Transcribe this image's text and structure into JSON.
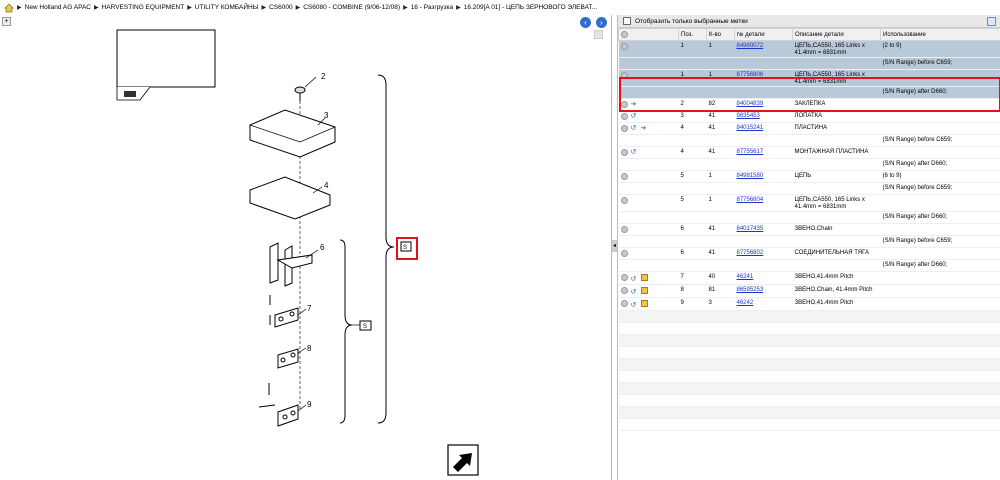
{
  "breadcrumb": {
    "items": [
      "New Holland AG APAC",
      "HARVESTING EQUIPMENT",
      "UTILITY КОМБАЙНЫ",
      "CS6000",
      "CS6080 - COMBINE (9/06-12/08)",
      "16 - Разгрузка",
      "16.209[A 01] - ЦЕПЬ ЗЕРНОВОГО ЭЛЕВАТ..."
    ]
  },
  "diagram": {
    "callouts": [
      "2",
      "3",
      "4",
      "6",
      "7",
      "8",
      "9"
    ],
    "box_s": "S",
    "box_s2": "S"
  },
  "filter": {
    "label": "Отобразить только выбранные метки"
  },
  "table": {
    "headers": [
      "",
      "Поз.",
      "К-во",
      "№ детали",
      "Описание детали",
      "Использование"
    ],
    "rows": [
      {
        "cls": "sel",
        "icons": [
          "dot"
        ],
        "pos": "1",
        "qty": "1",
        "part": "84980072",
        "desc": "ЦЕПЬ,CA550, 165 Links x 41.4mm = 6831mm",
        "usage": "(2 to 9)"
      },
      {
        "cls": "sel",
        "icons": [],
        "pos": "",
        "qty": "",
        "part": "",
        "desc": "",
        "usage": "(S/N Range) before C659;"
      },
      {
        "cls": "sel2",
        "icons": [
          "dot"
        ],
        "pos": "1",
        "qty": "1",
        "part": "87756806",
        "desc": "ЦЕПЬ,CA550, 165 Links x 41.4mm = 6831mm",
        "usage": ""
      },
      {
        "cls": "sel2",
        "icons": [],
        "pos": "",
        "qty": "",
        "part": "",
        "desc": "",
        "usage": "(S/N Range) after D660;"
      },
      {
        "cls": "",
        "icons": [
          "dot",
          "green"
        ],
        "pos": "2",
        "qty": "82",
        "part": "84004839",
        "desc": "ЗАКЛЕПКА",
        "usage": ""
      },
      {
        "cls": "",
        "icons": [
          "dot",
          "blue"
        ],
        "pos": "3",
        "qty": "41",
        "part": "9835453",
        "desc": "ЛОПАТКА",
        "usage": ""
      },
      {
        "cls": "",
        "icons": [
          "dot",
          "blue",
          "green"
        ],
        "pos": "4",
        "qty": "41",
        "part": "84015241",
        "desc": "ПЛАСТИНА",
        "usage": ""
      },
      {
        "cls": "",
        "icons": [],
        "pos": "",
        "qty": "",
        "part": "",
        "desc": "",
        "usage": "(S/N Range) before C659;"
      },
      {
        "cls": "",
        "icons": [
          "dot",
          "blue"
        ],
        "pos": "4",
        "qty": "41",
        "part": "87755617",
        "desc": "МОНТАЖНАЯ ПЛАСТИНА",
        "usage": ""
      },
      {
        "cls": "",
        "icons": [],
        "pos": "",
        "qty": "",
        "part": "",
        "desc": "",
        "usage": "(S/N Range) after D660;"
      },
      {
        "cls": "",
        "icons": [
          "dot"
        ],
        "pos": "5",
        "qty": "1",
        "part": "84981580",
        "desc": "ЦЕПЬ",
        "usage": "(6 to 9)"
      },
      {
        "cls": "",
        "icons": [],
        "pos": "",
        "qty": "",
        "part": "",
        "desc": "",
        "usage": "(S/N Range) before C659;"
      },
      {
        "cls": "",
        "icons": [
          "dot"
        ],
        "pos": "5",
        "qty": "1",
        "part": "87756804",
        "desc": "ЦЕПЬ,CA550, 165 Links x 41.4mm = 6831mm",
        "usage": ""
      },
      {
        "cls": "",
        "icons": [],
        "pos": "",
        "qty": "",
        "part": "",
        "desc": "",
        "usage": "(S/N Range) after D660;"
      },
      {
        "cls": "",
        "icons": [
          "dot"
        ],
        "pos": "6",
        "qty": "41",
        "part": "84017435",
        "desc": "ЗВЕНО,Chain",
        "usage": ""
      },
      {
        "cls": "",
        "icons": [],
        "pos": "",
        "qty": "",
        "part": "",
        "desc": "",
        "usage": "(S/N Range) before C659;"
      },
      {
        "cls": "",
        "icons": [
          "dot"
        ],
        "pos": "6",
        "qty": "41",
        "part": "87756802",
        "desc": "СОЕДИНИТЕЛЬНАЯ ТЯГА",
        "usage": ""
      },
      {
        "cls": "",
        "icons": [],
        "pos": "",
        "qty": "",
        "part": "",
        "desc": "",
        "usage": "(S/N Range) after D660;"
      },
      {
        "cls": "",
        "icons": [
          "dot",
          "blue",
          "cube"
        ],
        "pos": "7",
        "qty": "40",
        "part": "46241",
        "desc": "ЗВЕНО,41.4mm Pitch",
        "usage": ""
      },
      {
        "cls": "",
        "icons": [
          "dot",
          "blue",
          "cube"
        ],
        "pos": "8",
        "qty": "81",
        "part": "86595253",
        "desc": "ЗВЕНО,Chain, 41.4mm Pitch",
        "usage": ""
      },
      {
        "cls": "",
        "icons": [
          "dot",
          "blue",
          "cube"
        ],
        "pos": "9",
        "qty": "3",
        "part": "46242",
        "desc": "ЗВЕНО,41.4mm Pitch",
        "usage": ""
      }
    ]
  }
}
